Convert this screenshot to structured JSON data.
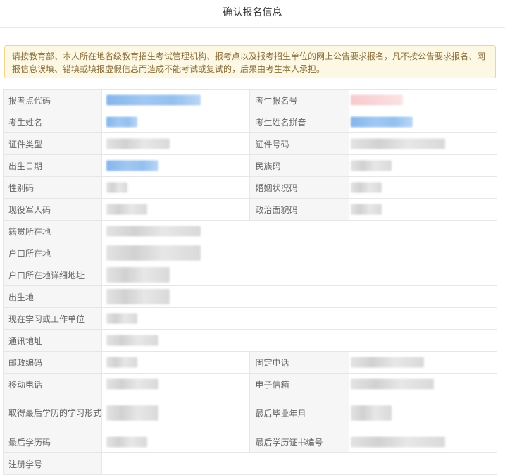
{
  "page": {
    "title": "确认报名信息"
  },
  "notice": {
    "text": "请按教育部、本人所在地省级教育招生考试管理机构、报考点以及报考招生单位的网上公告要求报名，凡不按公告要求报名、网报信息误填、错填或填报虚假信息而造成不能考试或复试的，后果由考生本人承担。"
  },
  "form": {
    "exam_site_code": "报考点代码",
    "registration_no": "考生报名号",
    "name": "考生姓名",
    "name_pinyin": "考生姓名拼音",
    "id_type": "证件类型",
    "id_number": "证件号码",
    "birth_date": "出生日期",
    "ethnicity_code": "民族码",
    "gender_code": "性别码",
    "marital_code": "婚姻状况码",
    "military_code": "现役军人码",
    "political_code": "政治面貌码",
    "native_place": "籍贯所在地",
    "household": "户口所在地",
    "household_address": "户口所在地详细地址",
    "birthplace": "出生地",
    "current_unit": "现在学习或工作单位",
    "mailing_address": "通讯地址",
    "postal_code": "邮政编码",
    "landline": "固定电话",
    "mobile": "移动电话",
    "email": "电子信箱",
    "degree_study_form": "取得最后学历的学习形式",
    "grad_year_month": "最后毕业年月",
    "last_degree_code": "最后学历码",
    "degree_cert_no": "最后学历证书编号",
    "student_reg_no": "注册学号"
  }
}
